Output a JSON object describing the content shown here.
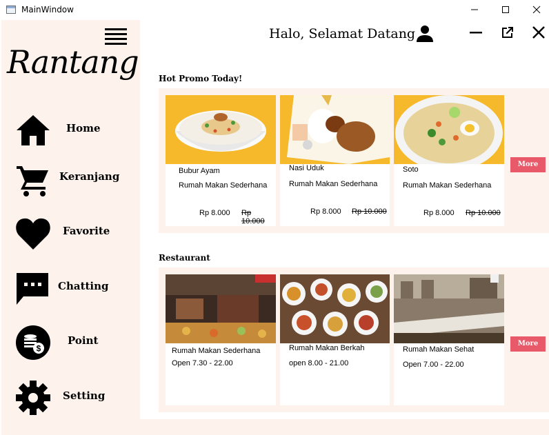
{
  "window": {
    "title": "MainWindow"
  },
  "sidebar": {
    "logo": "Rantang",
    "items": [
      {
        "label": "Home",
        "icon": "home-icon"
      },
      {
        "label": "Keranjang",
        "icon": "cart-icon"
      },
      {
        "label": "Favorite",
        "icon": "heart-icon"
      },
      {
        "label": "Chatting",
        "icon": "chat-icon"
      },
      {
        "label": "Point",
        "icon": "coins-icon"
      },
      {
        "label": "Setting",
        "icon": "gear-icon"
      }
    ]
  },
  "header": {
    "greeting": "Halo, Selamat Datang"
  },
  "promo": {
    "title": "Hot Promo Today!",
    "more_label": "More",
    "items": [
      {
        "name": "Bubur Ayam",
        "restaurant": "Rumah Makan Sederhana",
        "price": "Rp 8.000",
        "old_price": "Rp 10.000"
      },
      {
        "name": "Nasi Uduk",
        "restaurant": "Rumah Makan Sederhana",
        "price": "Rp 8.000",
        "old_price": "Rp 10.000"
      },
      {
        "name": "Soto",
        "restaurant": "Rumah Makan Sederhana",
        "price": "Rp 8.000",
        "old_price": "Rp 10.000"
      }
    ]
  },
  "restaurants": {
    "title": "Restaurant",
    "more_label": "More",
    "items": [
      {
        "name": "Rumah Makan Sederhana",
        "hours": "Open 7.30 - 22.00"
      },
      {
        "name": "Rumah Makan Berkah",
        "hours": "open 8.00 - 21.00"
      },
      {
        "name": "Rumah Makan Sehat",
        "hours": "Open 7.00 - 22.00"
      }
    ]
  },
  "colors": {
    "sidebar_bg": "#fdf3ec",
    "panel_bg": "#fdf3ec",
    "accent": "#e85a6a",
    "food_bg": "#f6b92b"
  }
}
